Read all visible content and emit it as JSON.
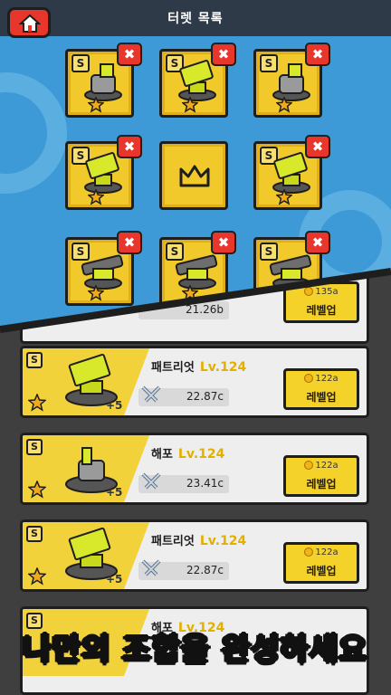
{
  "header": {
    "title": "터렛 목록"
  },
  "grid": {
    "badge": "S",
    "close_label": "✖",
    "partial_cost": "135a",
    "partial_level_up": "레벨업",
    "partial_attack": "21.26b"
  },
  "list": [
    {
      "badge": "S",
      "name": "패트리엇",
      "level": "Lv.124",
      "attack": "22.87c",
      "bonus": "+5",
      "cost": "122a",
      "level_up": "레벨업"
    },
    {
      "badge": "S",
      "name": "해포",
      "level": "Lv.124",
      "attack": "23.41c",
      "bonus": "+5",
      "cost": "122a",
      "level_up": "레벨업"
    },
    {
      "badge": "S",
      "name": "패트리엇",
      "level": "Lv.124",
      "attack": "22.87c",
      "bonus": "+5",
      "cost": "122a",
      "level_up": "레벨업"
    },
    {
      "badge": "S",
      "name": "해포",
      "level": "Lv.124"
    }
  ],
  "banner": {
    "text": "나만의 조합을 완성하세요"
  },
  "colors": {
    "accent_yellow": "#f1c92a",
    "close_red": "#e8362c",
    "panel_blue": "#3d9ad6"
  }
}
